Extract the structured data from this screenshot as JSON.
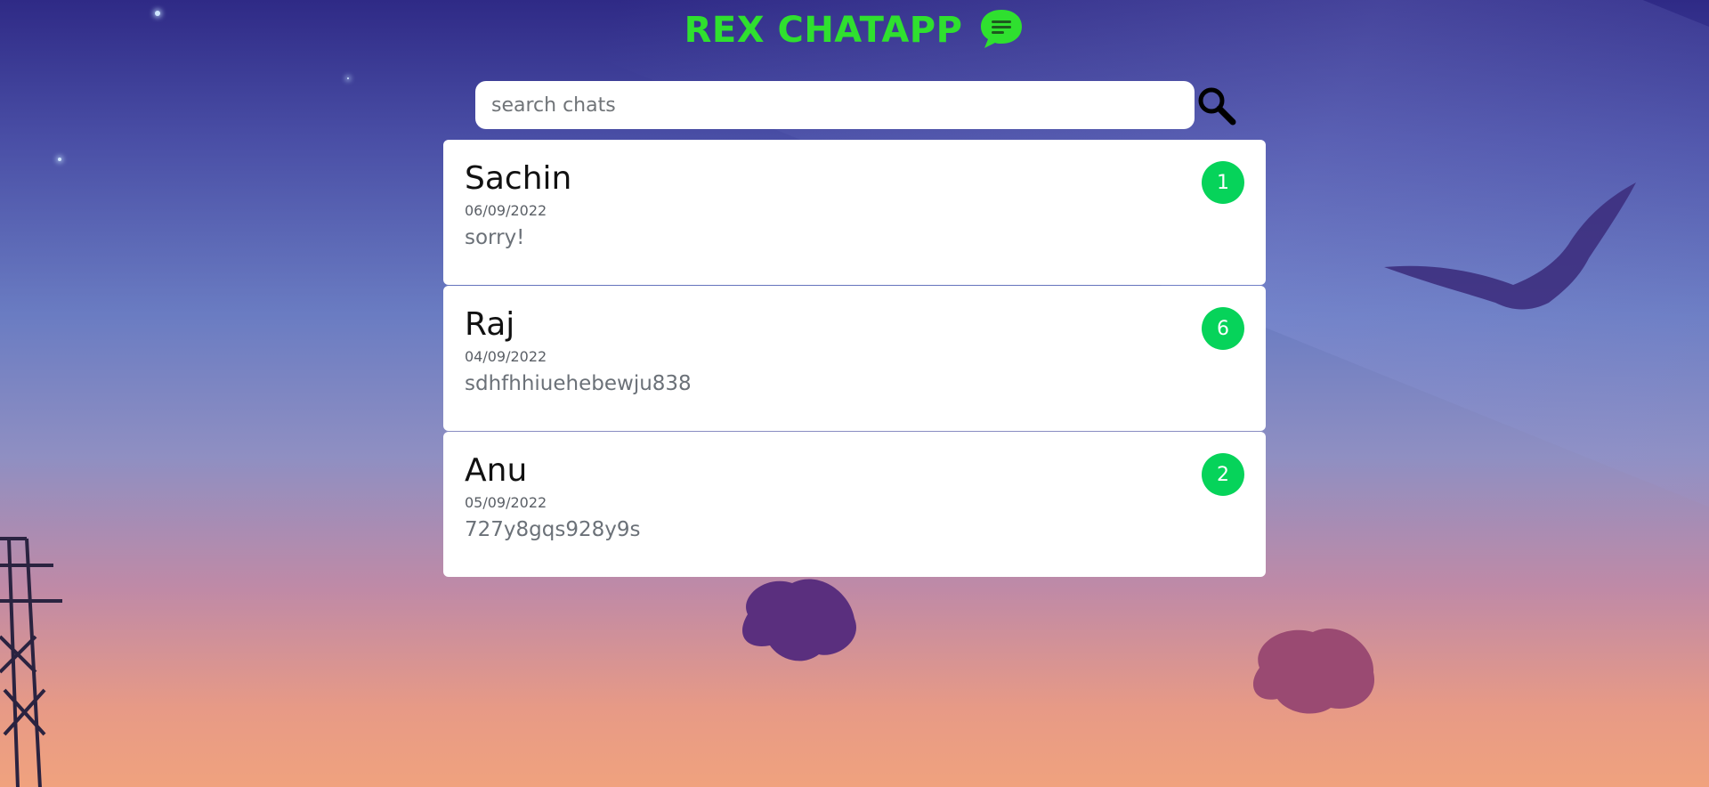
{
  "header": {
    "title": "REX CHATAPP",
    "icon": "chat-bubble-icon",
    "accent_color": "#2fe02f"
  },
  "search": {
    "placeholder": "search chats",
    "value": "",
    "icon": "search-icon"
  },
  "chats": [
    {
      "name": "Sachin",
      "date": "06/09/2022",
      "last_message": "sorry!",
      "unread": "1"
    },
    {
      "name": "Raj",
      "date": "04/09/2022",
      "last_message": "sdhfhhiuehebewju838",
      "unread": "6"
    },
    {
      "name": "Anu",
      "date": "05/09/2022",
      "last_message": "727y8gqs928y9s",
      "unread": "2"
    }
  ],
  "colors": {
    "badge": "#06d35a",
    "card": "#ffffff"
  }
}
